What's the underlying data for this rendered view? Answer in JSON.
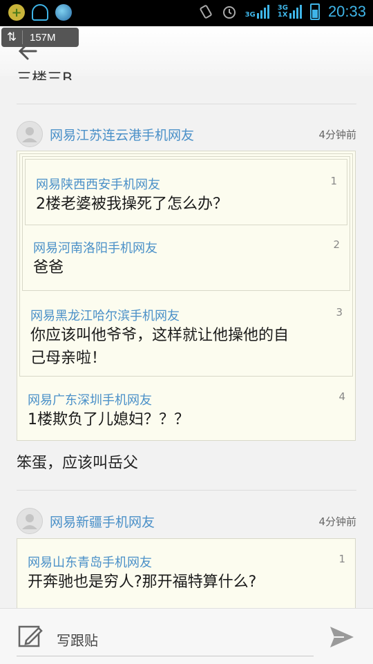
{
  "status_bar": {
    "time": "20:33",
    "network_1": "3G",
    "network_2": "3G",
    "network_2_sub": "1X",
    "icons": [
      "add-app-icon",
      "notification-icon",
      "browser-icon",
      "vibrate-icon",
      "alarm-icon",
      "signal-icon",
      "battery-icon"
    ]
  },
  "memory_pill": {
    "value": "157M"
  },
  "header": {
    "back_icon": "back-arrow-icon"
  },
  "thread": {
    "partial_previous_text": "三楼三B",
    "posts": [
      {
        "user": "网易江苏连云港手机网友",
        "time": "4分钟前",
        "quotes": [
          {
            "user": "网易陕西西安手机网友",
            "floor": "1",
            "text": "2楼老婆被我操死了怎么办？"
          },
          {
            "user": "网易河南洛阳手机网友",
            "floor": "2",
            "text": "爸爸"
          },
          {
            "user": "网易黑龙江哈尔滨手机网友",
            "floor": "3",
            "text_line1": "你应该叫他爷爷，这样就让他操他的自",
            "text_line2": "己母亲啦！"
          },
          {
            "user": "网易广东深圳手机网友",
            "floor": "4",
            "text": "1楼欺负了儿媳妇？？？"
          }
        ],
        "reply": "笨蛋，应该叫岳父"
      },
      {
        "user": "网易新疆手机网友",
        "time": "4分钟前",
        "quotes": [
          {
            "user": "网易山东青岛手机网友",
            "floor": "1",
            "text": "开奔驰也是穷人?那开福特算什么?"
          }
        ]
      }
    ]
  },
  "bottom_bar": {
    "placeholder": "写跟贴",
    "write_icon": "edit-icon",
    "send_icon": "send-icon"
  },
  "colors": {
    "accent": "#3fb5e8",
    "username": "#4a90c8",
    "quote_bg": "#fcfcef"
  }
}
